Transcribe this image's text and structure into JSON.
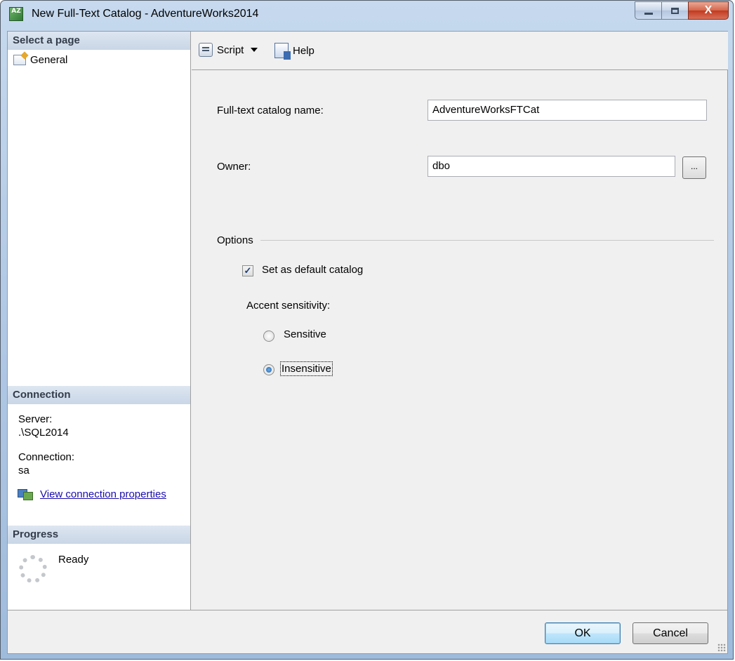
{
  "window": {
    "title": "New Full-Text Catalog - AdventureWorks2014",
    "app_icon_text": "AZ",
    "controls": {
      "minimize_icon": "minimize-icon",
      "maximize_icon": "maximize-icon",
      "close_icon": "close-icon",
      "close_glyph": "X"
    }
  },
  "sidebar": {
    "select_page_header": "Select a page",
    "pages": [
      {
        "label": "General",
        "icon": "page-settings-icon"
      }
    ],
    "connection": {
      "header": "Connection",
      "server_label": "Server:",
      "server_value": ".\\SQL2014",
      "connection_label": "Connection:",
      "connection_value": "sa",
      "link_text": "View connection properties",
      "link_icon": "connection-properties-icon"
    },
    "progress": {
      "header": "Progress",
      "status": "Ready",
      "icon": "progress-spinner-icon"
    }
  },
  "toolbar": {
    "script_label": "Script",
    "script_icon": "script-icon",
    "help_label": "Help",
    "help_icon": "help-icon"
  },
  "form": {
    "catalog_name_label": "Full-text catalog name:",
    "catalog_name_value": "AdventureWorksFTCat",
    "owner_label": "Owner:",
    "owner_value": "dbo",
    "owner_browse_label": "...",
    "options_label": "Options",
    "default_catalog_label": "Set as default catalog",
    "default_catalog_checked": true,
    "accent_sensitivity_label": "Accent sensitivity:",
    "accent_options": [
      {
        "label": "Sensitive",
        "selected": false
      },
      {
        "label": "Insensitive",
        "selected": true
      }
    ]
  },
  "footer": {
    "ok_label": "OK",
    "cancel_label": "Cancel"
  },
  "colors": {
    "title_bar": "#b4cbe6",
    "section_header": "#c9d6e6",
    "link": "#1a0dab",
    "close_button": "#c2391e"
  }
}
